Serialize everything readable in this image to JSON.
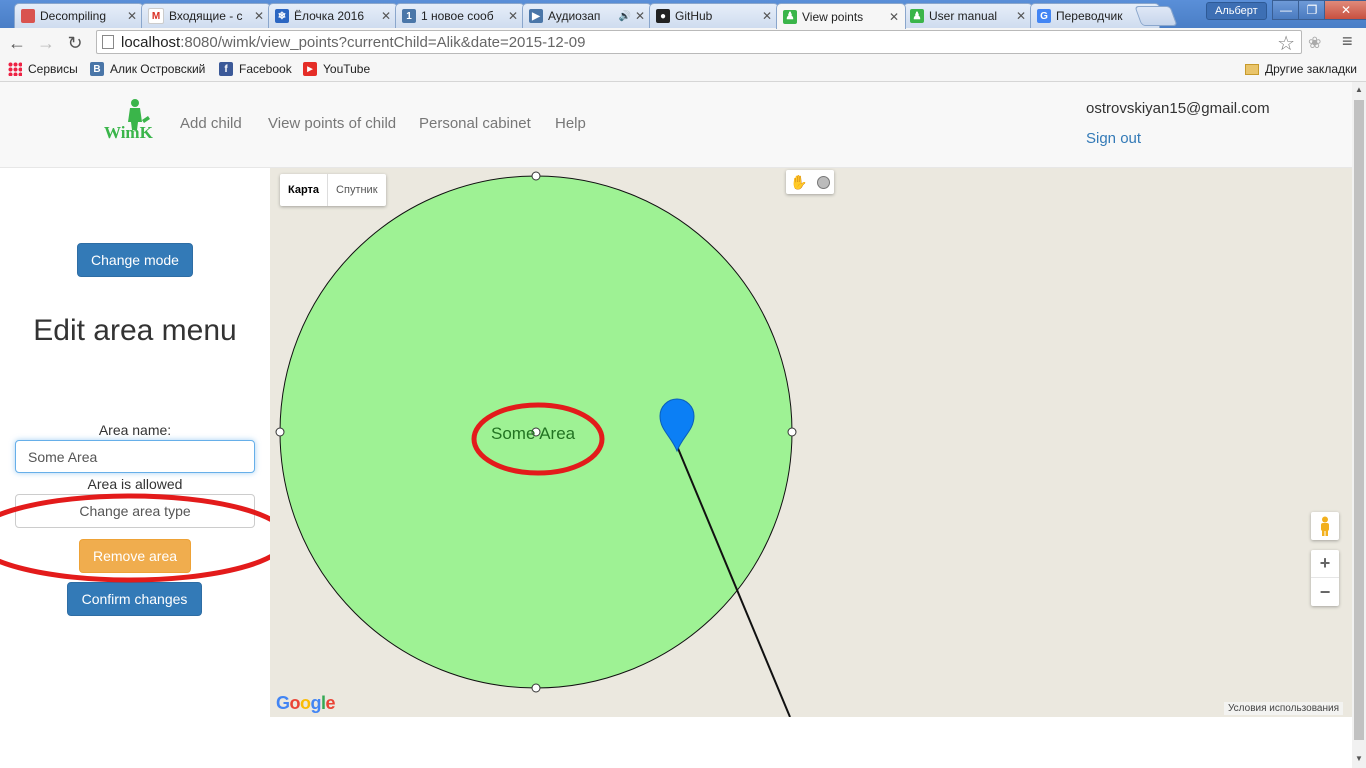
{
  "browser": {
    "tabs": [
      {
        "label": "Decompiling",
        "fav_color": "#d9534f",
        "fav_glyph": ""
      },
      {
        "label": "Входящие - c",
        "fav_color": "#ffffff",
        "fav_glyph": "M"
      },
      {
        "label": "Ёлочка 2016",
        "fav_color": "#2b66c2",
        "fav_glyph": "❄"
      },
      {
        "label": "1 новое сооб",
        "fav_color": "#4a76a8",
        "fav_glyph": "1"
      },
      {
        "label": "Аудиозап",
        "fav_color": "#4a76a8",
        "fav_glyph": "▶"
      },
      {
        "label": "GitHub",
        "fav_color": "#222222",
        "fav_glyph": "●"
      },
      {
        "label": "View points",
        "fav_color": "#3ab54a",
        "fav_glyph": "♟"
      },
      {
        "label": "User manual",
        "fav_color": "#3ab54a",
        "fav_glyph": "♟"
      },
      {
        "label": "Переводчик",
        "fav_color": "#4285f4",
        "fav_glyph": "G"
      }
    ],
    "active_tab_index": 6,
    "profile_name": "Альберт",
    "url_host": "localhost",
    "url_rest": ":8080/wimk/view_points?currentChild=Alik&date=2015-12-09",
    "bookmarks": [
      {
        "label": "Сервисы",
        "icon": "apps-icon"
      },
      {
        "label": "Алик Островский",
        "icon": "vk-icon",
        "color": "#4a76a8",
        "glyph": "B"
      },
      {
        "label": "Facebook",
        "icon": "facebook-icon",
        "color": "#3b5998",
        "glyph": "f"
      },
      {
        "label": "YouTube",
        "icon": "youtube-icon",
        "color": "#e52d27",
        "glyph": "▶"
      }
    ],
    "other_bookmarks": "Другие закладки"
  },
  "app": {
    "logo_text": "WimK",
    "nav": [
      "Add child",
      "View points of child",
      "Personal cabinet",
      "Help"
    ],
    "user_email": "ostrovskiyan15@gmail.com",
    "sign_out": "Sign out"
  },
  "sidebar": {
    "change_mode": "Change mode",
    "title": "Edit area menu",
    "area_name_label": "Area name:",
    "area_name_value": "Some Area",
    "area_status": "Area is allowed",
    "change_area_type": "Change area type",
    "remove_area": "Remove area",
    "confirm_changes": "Confirm changes"
  },
  "map": {
    "map_type_map": "Карта",
    "map_type_satellite": "Спутник",
    "area_label": "Some Area",
    "zoom_in": "+",
    "zoom_out": "−",
    "terms": "Условия использования",
    "circle_fill": "#9ef294",
    "marker_color": "#0b7ff5",
    "annotation_color": "#e31b1b"
  }
}
